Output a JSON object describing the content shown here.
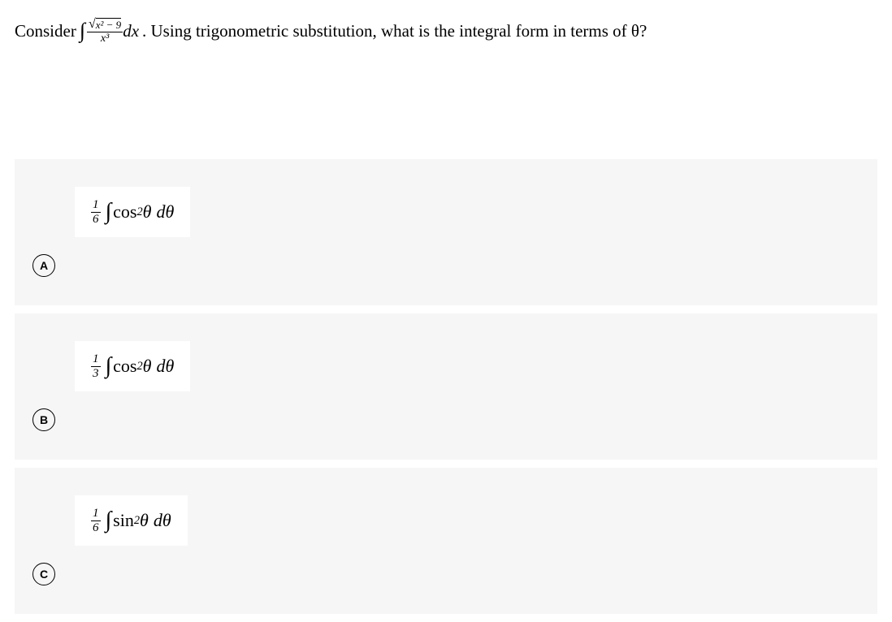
{
  "question": {
    "prefix": "Consider ",
    "integral_num_sqrt_body": "x² − 9",
    "integral_den": "x³",
    "dx": "dx",
    "suffix": ".  Using trigonometric substitution, what is the integral form in terms of θ?"
  },
  "options": [
    {
      "letter": "A",
      "frac_num": "1",
      "frac_den": "6",
      "trig": "cos",
      "dtheta": "dθ"
    },
    {
      "letter": "B",
      "frac_num": "1",
      "frac_den": "3",
      "trig": "cos",
      "dtheta": "dθ"
    },
    {
      "letter": "C",
      "frac_num": "1",
      "frac_den": "6",
      "trig": "sin",
      "dtheta": "dθ"
    }
  ]
}
